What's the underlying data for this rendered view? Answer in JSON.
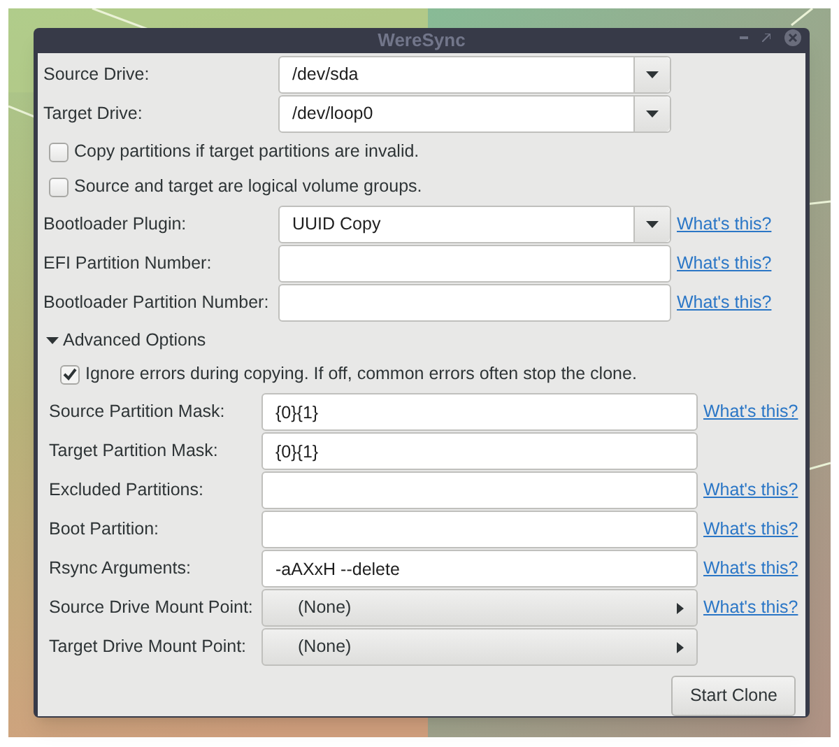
{
  "window": {
    "title": "WereSync"
  },
  "drive_rows": [
    {
      "kind": "combo",
      "label": "Source Drive:",
      "value": "/dev/sda"
    },
    {
      "kind": "combo",
      "label": "Target Drive:",
      "value": "/dev/loop0"
    }
  ],
  "options": [
    {
      "label": "Copy partitions if target partitions are invalid.",
      "checked": false
    },
    {
      "label": "Source and target are logical volume groups.",
      "checked": false
    }
  ],
  "boot_rows": [
    {
      "kind": "combo",
      "label": "Bootloader Plugin:",
      "value": "UUID Copy",
      "help": "What's this?"
    },
    {
      "kind": "entry",
      "label": "EFI Partition Number:",
      "value": "",
      "help": "What's this?"
    },
    {
      "kind": "entry",
      "label": "Bootloader Partition Number:",
      "value": "",
      "help": "What's this?"
    }
  ],
  "advanced": {
    "label": "Advanced Options",
    "expanded": true,
    "ignore_errors": {
      "label": "Ignore errors during copying. If off, common errors often stop the clone.",
      "checked": true
    },
    "rows": [
      {
        "kind": "entry",
        "label": "Source Partition Mask:",
        "value": "{0}{1}",
        "help": "What's this?"
      },
      {
        "kind": "entry",
        "label": "Target Partition Mask:",
        "value": "{0}{1}"
      },
      {
        "kind": "entry",
        "label": "Excluded Partitions:",
        "value": "",
        "help": "What's this?"
      },
      {
        "kind": "entry",
        "label": "Boot Partition:",
        "value": "",
        "help": "What's this?"
      },
      {
        "kind": "entry",
        "label": "Rsync Arguments:",
        "value": "-aAXxH --delete",
        "help": "What's this?"
      },
      {
        "kind": "menu",
        "label": "Source Drive Mount Point:",
        "value": "(None)",
        "help": "What's this?"
      },
      {
        "kind": "menu",
        "label": "Target Drive Mount Point:",
        "value": "(None)"
      }
    ]
  },
  "start_button": "Start Clone"
}
